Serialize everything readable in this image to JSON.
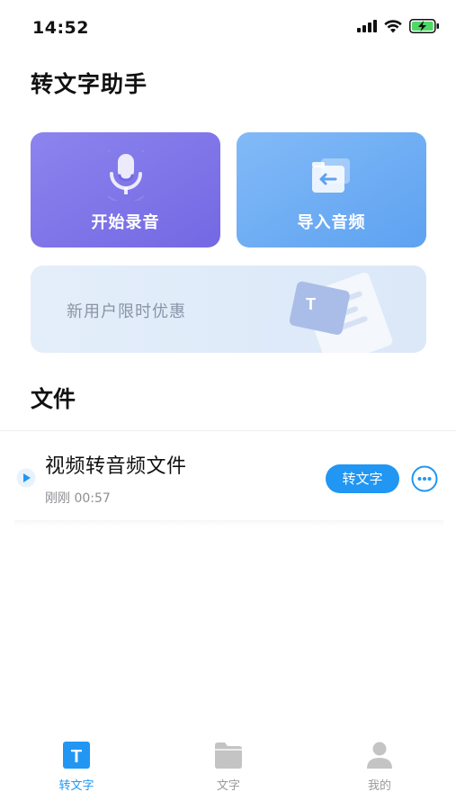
{
  "status_bar": {
    "time": "14:52"
  },
  "header": {
    "title": "转文字助手"
  },
  "actions": {
    "record_label": "开始录音",
    "import_label": "导入音频",
    "promo_label": "新用户限时优惠",
    "promo_badge_letter": "T"
  },
  "files": {
    "section_title": "文件",
    "items": [
      {
        "name": "视频转音频文件",
        "meta": "刚刚 00:57",
        "convert_label": "转文字"
      }
    ]
  },
  "tab_bar": {
    "tabs": [
      {
        "label": "转文字",
        "icon_letter": "T",
        "active": true
      },
      {
        "label": "文字",
        "active": false
      },
      {
        "label": "我的",
        "active": false
      }
    ]
  },
  "colors": {
    "accent": "#2196f3",
    "record_card": "#7c72ea",
    "import_card": "#6aaaf3",
    "promo_card": "#e0ebf9"
  }
}
